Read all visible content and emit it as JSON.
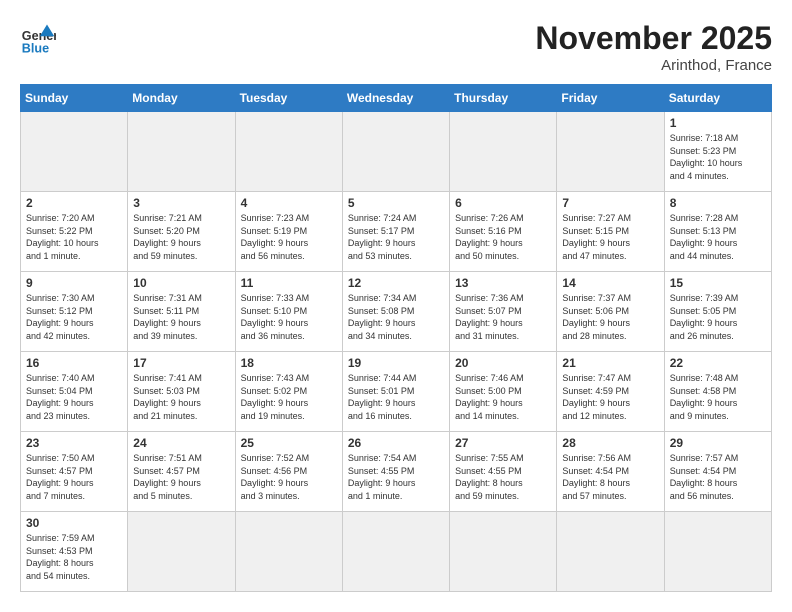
{
  "header": {
    "logo_general": "General",
    "logo_blue": "Blue",
    "month_title": "November 2025",
    "location": "Arinthod, France"
  },
  "days_of_week": [
    "Sunday",
    "Monday",
    "Tuesday",
    "Wednesday",
    "Thursday",
    "Friday",
    "Saturday"
  ],
  "weeks": [
    [
      {
        "day": "",
        "info": "",
        "empty": true
      },
      {
        "day": "",
        "info": "",
        "empty": true
      },
      {
        "day": "",
        "info": "",
        "empty": true
      },
      {
        "day": "",
        "info": "",
        "empty": true
      },
      {
        "day": "",
        "info": "",
        "empty": true
      },
      {
        "day": "",
        "info": "",
        "empty": true
      },
      {
        "day": "1",
        "info": "Sunrise: 7:18 AM\nSunset: 5:23 PM\nDaylight: 10 hours\nand 4 minutes.",
        "empty": false
      }
    ],
    [
      {
        "day": "2",
        "info": "Sunrise: 7:20 AM\nSunset: 5:22 PM\nDaylight: 10 hours\nand 1 minute.",
        "empty": false
      },
      {
        "day": "3",
        "info": "Sunrise: 7:21 AM\nSunset: 5:20 PM\nDaylight: 9 hours\nand 59 minutes.",
        "empty": false
      },
      {
        "day": "4",
        "info": "Sunrise: 7:23 AM\nSunset: 5:19 PM\nDaylight: 9 hours\nand 56 minutes.",
        "empty": false
      },
      {
        "day": "5",
        "info": "Sunrise: 7:24 AM\nSunset: 5:17 PM\nDaylight: 9 hours\nand 53 minutes.",
        "empty": false
      },
      {
        "day": "6",
        "info": "Sunrise: 7:26 AM\nSunset: 5:16 PM\nDaylight: 9 hours\nand 50 minutes.",
        "empty": false
      },
      {
        "day": "7",
        "info": "Sunrise: 7:27 AM\nSunset: 5:15 PM\nDaylight: 9 hours\nand 47 minutes.",
        "empty": false
      },
      {
        "day": "8",
        "info": "Sunrise: 7:28 AM\nSunset: 5:13 PM\nDaylight: 9 hours\nand 44 minutes.",
        "empty": false
      }
    ],
    [
      {
        "day": "9",
        "info": "Sunrise: 7:30 AM\nSunset: 5:12 PM\nDaylight: 9 hours\nand 42 minutes.",
        "empty": false
      },
      {
        "day": "10",
        "info": "Sunrise: 7:31 AM\nSunset: 5:11 PM\nDaylight: 9 hours\nand 39 minutes.",
        "empty": false
      },
      {
        "day": "11",
        "info": "Sunrise: 7:33 AM\nSunset: 5:10 PM\nDaylight: 9 hours\nand 36 minutes.",
        "empty": false
      },
      {
        "day": "12",
        "info": "Sunrise: 7:34 AM\nSunset: 5:08 PM\nDaylight: 9 hours\nand 34 minutes.",
        "empty": false
      },
      {
        "day": "13",
        "info": "Sunrise: 7:36 AM\nSunset: 5:07 PM\nDaylight: 9 hours\nand 31 minutes.",
        "empty": false
      },
      {
        "day": "14",
        "info": "Sunrise: 7:37 AM\nSunset: 5:06 PM\nDaylight: 9 hours\nand 28 minutes.",
        "empty": false
      },
      {
        "day": "15",
        "info": "Sunrise: 7:39 AM\nSunset: 5:05 PM\nDaylight: 9 hours\nand 26 minutes.",
        "empty": false
      }
    ],
    [
      {
        "day": "16",
        "info": "Sunrise: 7:40 AM\nSunset: 5:04 PM\nDaylight: 9 hours\nand 23 minutes.",
        "empty": false
      },
      {
        "day": "17",
        "info": "Sunrise: 7:41 AM\nSunset: 5:03 PM\nDaylight: 9 hours\nand 21 minutes.",
        "empty": false
      },
      {
        "day": "18",
        "info": "Sunrise: 7:43 AM\nSunset: 5:02 PM\nDaylight: 9 hours\nand 19 minutes.",
        "empty": false
      },
      {
        "day": "19",
        "info": "Sunrise: 7:44 AM\nSunset: 5:01 PM\nDaylight: 9 hours\nand 16 minutes.",
        "empty": false
      },
      {
        "day": "20",
        "info": "Sunrise: 7:46 AM\nSunset: 5:00 PM\nDaylight: 9 hours\nand 14 minutes.",
        "empty": false
      },
      {
        "day": "21",
        "info": "Sunrise: 7:47 AM\nSunset: 4:59 PM\nDaylight: 9 hours\nand 12 minutes.",
        "empty": false
      },
      {
        "day": "22",
        "info": "Sunrise: 7:48 AM\nSunset: 4:58 PM\nDaylight: 9 hours\nand 9 minutes.",
        "empty": false
      }
    ],
    [
      {
        "day": "23",
        "info": "Sunrise: 7:50 AM\nSunset: 4:57 PM\nDaylight: 9 hours\nand 7 minutes.",
        "empty": false
      },
      {
        "day": "24",
        "info": "Sunrise: 7:51 AM\nSunset: 4:57 PM\nDaylight: 9 hours\nand 5 minutes.",
        "empty": false
      },
      {
        "day": "25",
        "info": "Sunrise: 7:52 AM\nSunset: 4:56 PM\nDaylight: 9 hours\nand 3 minutes.",
        "empty": false
      },
      {
        "day": "26",
        "info": "Sunrise: 7:54 AM\nSunset: 4:55 PM\nDaylight: 9 hours\nand 1 minute.",
        "empty": false
      },
      {
        "day": "27",
        "info": "Sunrise: 7:55 AM\nSunset: 4:55 PM\nDaylight: 8 hours\nand 59 minutes.",
        "empty": false
      },
      {
        "day": "28",
        "info": "Sunrise: 7:56 AM\nSunset: 4:54 PM\nDaylight: 8 hours\nand 57 minutes.",
        "empty": false
      },
      {
        "day": "29",
        "info": "Sunrise: 7:57 AM\nSunset: 4:54 PM\nDaylight: 8 hours\nand 56 minutes.",
        "empty": false
      }
    ],
    [
      {
        "day": "30",
        "info": "Sunrise: 7:59 AM\nSunset: 4:53 PM\nDaylight: 8 hours\nand 54 minutes.",
        "empty": false
      },
      {
        "day": "",
        "info": "",
        "empty": true
      },
      {
        "day": "",
        "info": "",
        "empty": true
      },
      {
        "day": "",
        "info": "",
        "empty": true
      },
      {
        "day": "",
        "info": "",
        "empty": true
      },
      {
        "day": "",
        "info": "",
        "empty": true
      },
      {
        "day": "",
        "info": "",
        "empty": true
      }
    ]
  ]
}
